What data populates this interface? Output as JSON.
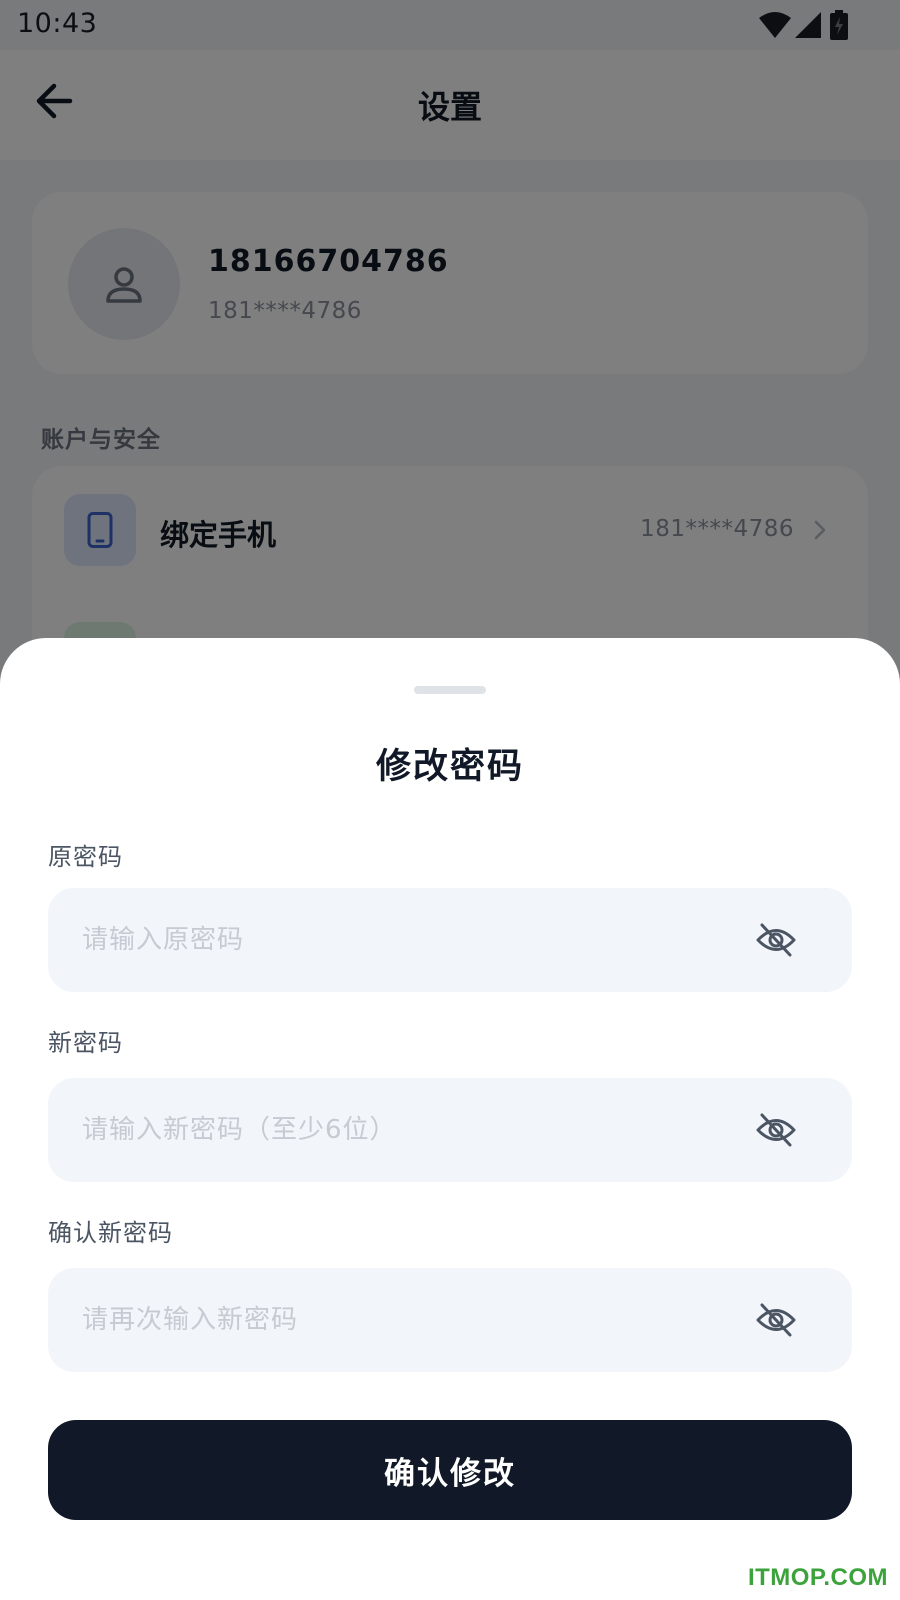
{
  "status_bar": {
    "time": "10:43",
    "icons": [
      "wifi-icon",
      "cellular-signal-icon",
      "battery-charging-icon"
    ]
  },
  "app_bar": {
    "title": "设置",
    "back_icon": "arrow-left-icon"
  },
  "profile": {
    "name": "18166704786",
    "phone": "181****4786",
    "avatar_icon": "user-icon"
  },
  "account_section": {
    "label": "账户与安全",
    "items": [
      {
        "label": "绑定手机",
        "value": "181****4786",
        "icon": "phone-icon",
        "chevron": "chevron-right-icon"
      }
    ]
  },
  "sheet": {
    "title": "修改密码",
    "fields": [
      {
        "label": "原密码",
        "value": "",
        "placeholder": "请输入原密码",
        "toggle_icon": "eye-off-icon"
      },
      {
        "label": "新密码",
        "value": "",
        "placeholder": "请输入新密码（至少6位）",
        "toggle_icon": "eye-off-icon"
      },
      {
        "label": "确认新密码",
        "value": "",
        "placeholder": "请再次输入新密码",
        "toggle_icon": "eye-off-icon"
      }
    ],
    "submit_label": "确认修改"
  },
  "watermark": "ITMOP.COM",
  "colors": {
    "primary_button": "#111827",
    "input_background": "#f2f5f9",
    "placeholder": "#c5cad3",
    "watermark": "#3ca23c"
  }
}
